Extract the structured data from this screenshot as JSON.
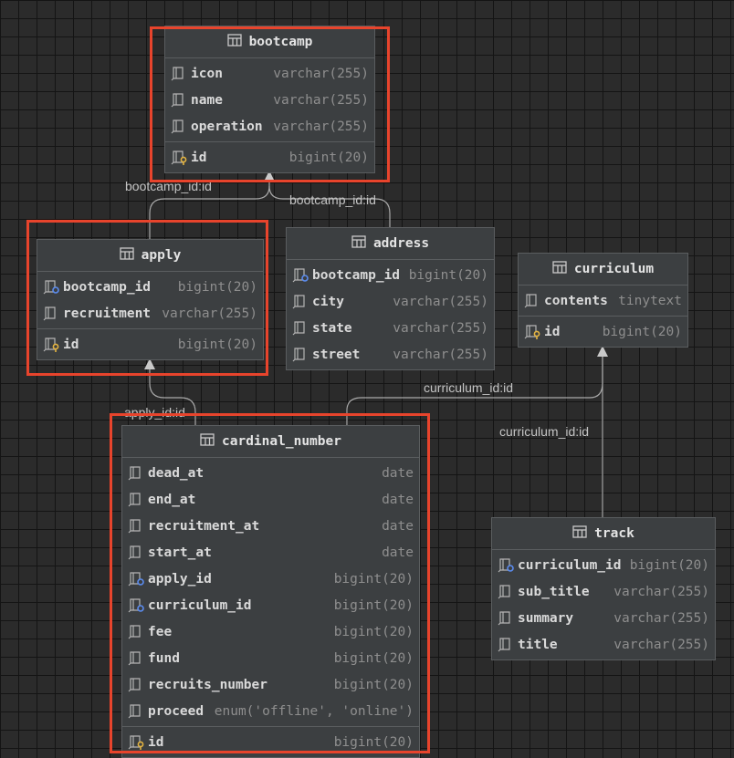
{
  "tables": {
    "bootcamp": {
      "name": "bootcamp",
      "columns": [
        {
          "name": "icon",
          "type": "varchar(255)",
          "icon": "column-icon"
        },
        {
          "name": "name",
          "type": "varchar(255)",
          "icon": "column-icon"
        },
        {
          "name": "operation",
          "type": "varchar(255)",
          "icon": "column-icon"
        }
      ],
      "pk": [
        {
          "name": "id",
          "type": "bigint(20)",
          "icon": "primary-key-icon"
        }
      ]
    },
    "apply": {
      "name": "apply",
      "columns": [
        {
          "name": "bootcamp_id",
          "type": "bigint(20)",
          "icon": "foreign-key-icon"
        },
        {
          "name": "recruitment",
          "type": "varchar(255)",
          "icon": "column-icon"
        }
      ],
      "pk": [
        {
          "name": "id",
          "type": "bigint(20)",
          "icon": "primary-key-icon"
        }
      ]
    },
    "address": {
      "name": "address",
      "columns": [
        {
          "name": "bootcamp_id",
          "type": "bigint(20)",
          "icon": "foreign-key-icon"
        },
        {
          "name": "city",
          "type": "varchar(255)",
          "icon": "column-icon"
        },
        {
          "name": "state",
          "type": "varchar(255)",
          "icon": "column-icon"
        },
        {
          "name": "street",
          "type": "varchar(255)",
          "icon": "column-icon"
        }
      ],
      "pk": []
    },
    "curriculum": {
      "name": "curriculum",
      "columns": [
        {
          "name": "contents",
          "type": "tinytext",
          "icon": "column-icon"
        }
      ],
      "pk": [
        {
          "name": "id",
          "type": "bigint(20)",
          "icon": "primary-key-icon"
        }
      ]
    },
    "cardinal_number": {
      "name": "cardinal_number",
      "columns": [
        {
          "name": "dead_at",
          "type": "date",
          "icon": "column-icon"
        },
        {
          "name": "end_at",
          "type": "date",
          "icon": "column-icon"
        },
        {
          "name": "recruitment_at",
          "type": "date",
          "icon": "column-icon"
        },
        {
          "name": "start_at",
          "type": "date",
          "icon": "column-icon"
        },
        {
          "name": "apply_id",
          "type": "bigint(20)",
          "icon": "foreign-key-icon"
        },
        {
          "name": "curriculum_id",
          "type": "bigint(20)",
          "icon": "foreign-key-icon"
        },
        {
          "name": "fee",
          "type": "bigint(20)",
          "icon": "column-icon"
        },
        {
          "name": "fund",
          "type": "bigint(20)",
          "icon": "column-icon"
        },
        {
          "name": "recruits_number",
          "type": "bigint(20)",
          "icon": "column-icon"
        },
        {
          "name": "proceed",
          "type": "enum('offline', 'online')",
          "icon": "column-icon"
        }
      ],
      "pk": [
        {
          "name": "id",
          "type": "bigint(20)",
          "icon": "primary-key-icon"
        }
      ]
    },
    "track": {
      "name": "track",
      "columns": [
        {
          "name": "curriculum_id",
          "type": "bigint(20)",
          "icon": "foreign-key-icon"
        },
        {
          "name": "sub_title",
          "type": "varchar(255)",
          "icon": "column-icon"
        },
        {
          "name": "summary",
          "type": "varchar(255)",
          "icon": "column-icon"
        },
        {
          "name": "title",
          "type": "varchar(255)",
          "icon": "column-icon"
        }
      ],
      "pk": []
    }
  },
  "relations": {
    "apply_bootcamp": "bootcamp_id:id",
    "address_bootcamp": "bootcamp_id:id",
    "cardinal_apply": "apply_id:id",
    "cardinal_curriculum": "curriculum_id:id",
    "track_curriculum": "curriculum_id:id"
  },
  "colors": {
    "highlight": "#e8442c",
    "connector": "#a9a9a9",
    "fk_dot": "#5b8cf0",
    "pk_dot": "#e3b341"
  }
}
